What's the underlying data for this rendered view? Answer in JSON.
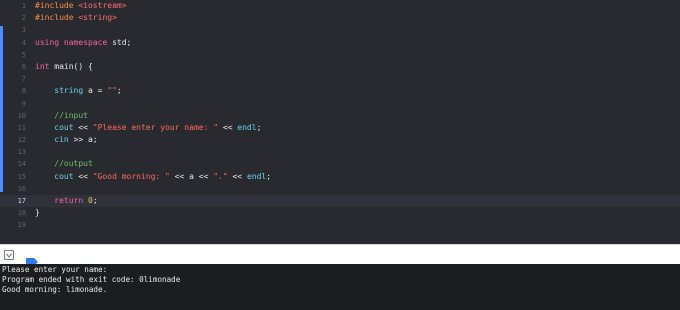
{
  "editor": {
    "lines": [
      {
        "n": "1",
        "tokens": [
          [
            "tok-preproc",
            "#include "
          ],
          [
            "tok-include",
            "<iostream>"
          ]
        ]
      },
      {
        "n": "2",
        "tokens": [
          [
            "tok-preproc",
            "#include "
          ],
          [
            "tok-include",
            "<string>"
          ]
        ]
      },
      {
        "n": "3",
        "tokens": []
      },
      {
        "n": "4",
        "tokens": [
          [
            "tok-kw",
            "using"
          ],
          [
            "tok-plain",
            " "
          ],
          [
            "tok-kw",
            "namespace"
          ],
          [
            "tok-plain",
            " std;"
          ]
        ]
      },
      {
        "n": "5",
        "tokens": []
      },
      {
        "n": "6",
        "tokens": [
          [
            "tok-kw",
            "int"
          ],
          [
            "tok-plain",
            " main() {"
          ]
        ]
      },
      {
        "n": "7",
        "tokens": []
      },
      {
        "n": "8",
        "tokens": [
          [
            "tok-plain",
            "    "
          ],
          [
            "tok-type",
            "string"
          ],
          [
            "tok-plain",
            " a = "
          ],
          [
            "tok-str",
            "\"\""
          ],
          [
            "tok-plain",
            ";"
          ]
        ]
      },
      {
        "n": "9",
        "tokens": []
      },
      {
        "n": "10",
        "tokens": [
          [
            "tok-plain",
            "    "
          ],
          [
            "tok-comment",
            "//input"
          ]
        ]
      },
      {
        "n": "11",
        "tokens": [
          [
            "tok-plain",
            "    "
          ],
          [
            "tok-type",
            "cout"
          ],
          [
            "tok-plain",
            " << "
          ],
          [
            "tok-str",
            "\"Please enter your name: \""
          ],
          [
            "tok-plain",
            " << "
          ],
          [
            "tok-type",
            "endl"
          ],
          [
            "tok-plain",
            ";"
          ]
        ]
      },
      {
        "n": "12",
        "tokens": [
          [
            "tok-plain",
            "    "
          ],
          [
            "tok-type",
            "cin"
          ],
          [
            "tok-plain",
            " >> a;"
          ]
        ]
      },
      {
        "n": "13",
        "tokens": []
      },
      {
        "n": "14",
        "tokens": [
          [
            "tok-plain",
            "    "
          ],
          [
            "tok-comment",
            "//output"
          ]
        ]
      },
      {
        "n": "15",
        "tokens": [
          [
            "tok-plain",
            "    "
          ],
          [
            "tok-type",
            "cout"
          ],
          [
            "tok-plain",
            " << "
          ],
          [
            "tok-str",
            "\"Good morning: \""
          ],
          [
            "tok-plain",
            " << a << "
          ],
          [
            "tok-str",
            "\".\""
          ],
          [
            "tok-plain",
            " << "
          ],
          [
            "tok-type",
            "endl"
          ],
          [
            "tok-plain",
            ";"
          ]
        ]
      },
      {
        "n": "16",
        "tokens": []
      },
      {
        "n": "17",
        "tokens": [
          [
            "tok-plain",
            "    "
          ],
          [
            "tok-kw",
            "return"
          ],
          [
            "tok-plain",
            " "
          ],
          [
            "tok-num",
            "0"
          ],
          [
            "tok-plain",
            ";"
          ]
        ],
        "current": true
      },
      {
        "n": "18",
        "tokens": [
          [
            "tok-plain",
            "}"
          ]
        ]
      },
      {
        "n": "19",
        "tokens": []
      }
    ]
  },
  "console": {
    "lines": [
      "Please enter your name:",
      "Program ended with exit code: 0limonade",
      "Good morning: limonade."
    ]
  },
  "icons": {
    "toggle": "chevron-down-icon",
    "breakpoint": "breakpoint-icon"
  },
  "colors": {
    "accent": "#4e8cff",
    "editor_bg": "#292a30",
    "console_bg": "#1c1d21"
  }
}
